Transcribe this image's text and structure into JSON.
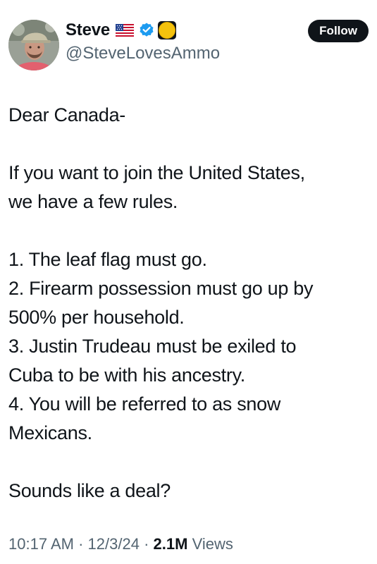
{
  "author": {
    "display_name": "Steve",
    "handle": "@SteveLovesAmmo",
    "flag_icon": "us-flag-icon",
    "verified_icon": "verified-badge-icon",
    "badge_icon": "yellow-circle-badge-icon",
    "verified_color": "#1d9bf0"
  },
  "follow_button": {
    "label": "Follow"
  },
  "post": {
    "lines": [
      "Dear Canada-",
      "",
      "If you want to join the United States,",
      "we have a few rules.",
      "",
      "1. The leaf flag must go.",
      "2. Firearm possession must go up by",
      "500% per household.",
      "3. Justin Trudeau must be exiled to",
      "Cuba to be with his ancestry.",
      "4. You will be referred to as snow",
      "Mexicans.",
      "",
      "Sounds like a deal?"
    ]
  },
  "meta": {
    "time": "10:17 AM",
    "separator": "·",
    "date": "12/3/24",
    "views_count": "2.1M",
    "views_label": "Views"
  }
}
